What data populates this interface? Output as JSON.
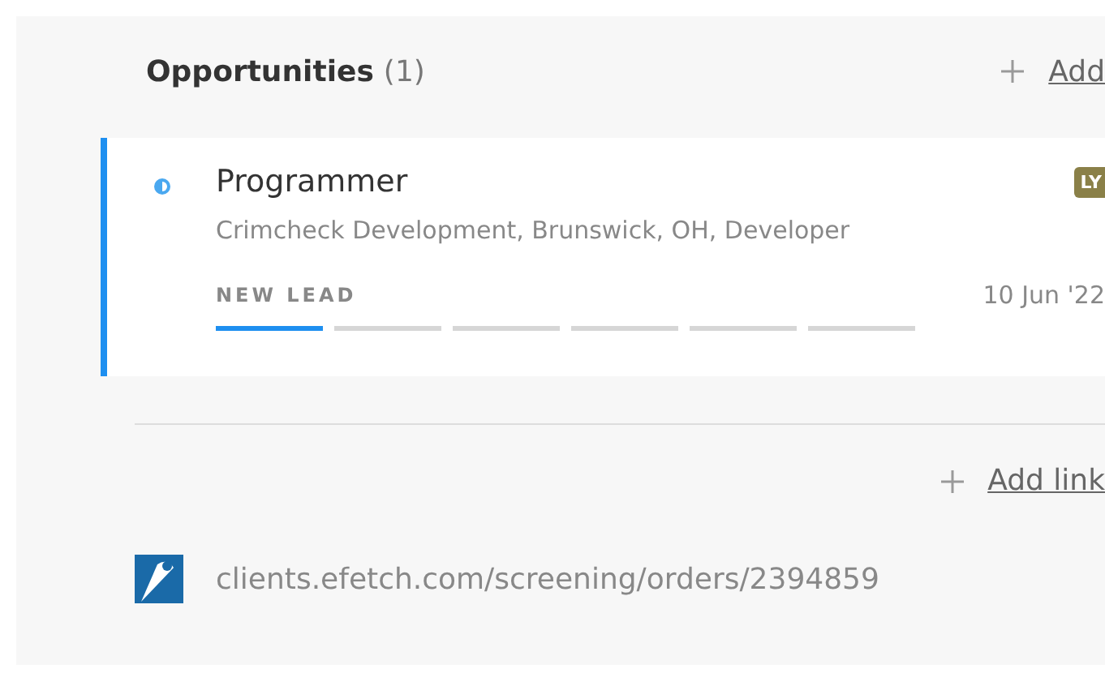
{
  "section": {
    "title": "Opportunities",
    "count": "(1)",
    "add_label": "Add"
  },
  "opportunities": [
    {
      "title": "Programmer",
      "subtitle": "Crimcheck Development, Brunswick, OH, Developer",
      "stage": "NEW LEAD",
      "date": "10 Jun '22",
      "owner": "LY",
      "selected": true,
      "steps": [
        {
          "done": true
        },
        {
          "done": false
        },
        {
          "done": false
        },
        {
          "done": false
        },
        {
          "done": false
        },
        {
          "done": false
        }
      ]
    }
  ],
  "links": {
    "add_label": "Add link",
    "items": [
      {
        "url": "clients.efetch.com/screening/orders/2394859"
      }
    ]
  }
}
